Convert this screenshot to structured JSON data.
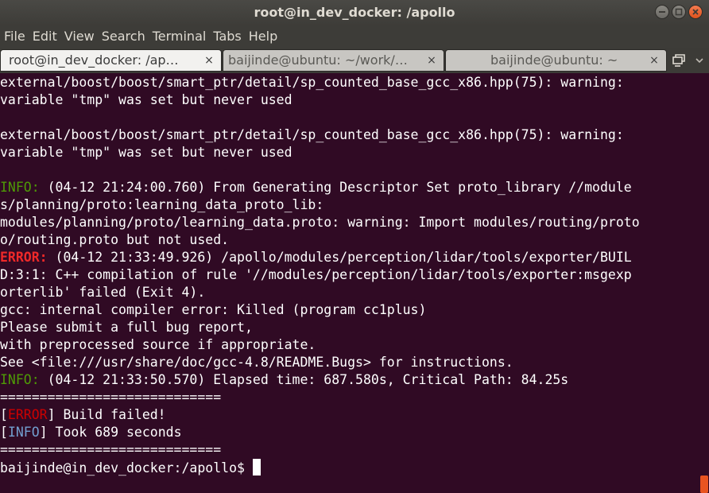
{
  "window": {
    "title": "root@in_dev_docker: /apollo"
  },
  "menu": [
    "File",
    "Edit",
    "View",
    "Search",
    "Terminal",
    "Tabs",
    "Help"
  ],
  "tabs": [
    {
      "label": "root@in_dev_docker: /ap…",
      "active": true
    },
    {
      "label": "baijinde@ubuntu: ~/work/…",
      "active": false
    },
    {
      "label": "baijinde@ubuntu: ~",
      "active": false
    }
  ],
  "tab_close_glyph": "×",
  "terminal": {
    "l1": "external/boost/boost/smart_ptr/detail/sp_counted_base_gcc_x86.hpp(75): warning:",
    "l2": "variable \"tmp\" was set but never used",
    "l3": "external/boost/boost/smart_ptr/detail/sp_counted_base_gcc_x86.hpp(75): warning:",
    "l4": "variable \"tmp\" was set but never used",
    "l5_tag": "INFO:",
    "l5_text": " (04-12 21:24:00.760) From Generating Descriptor Set proto_library //module",
    "l6": "s/planning/proto:learning_data_proto_lib:",
    "l7": "modules/planning/proto/learning_data.proto: warning: Import modules/routing/proto",
    "l8": "o/routing.proto but not used.",
    "l9_tag": "ERROR:",
    "l9_text": " (04-12 21:33:49.926) /apollo/modules/perception/lidar/tools/exporter/BUIL",
    "l10": "D:3:1: C++ compilation of rule '//modules/perception/lidar/tools/exporter:msgexp",
    "l11": "orterlib' failed (Exit 4).",
    "l12": "gcc: internal compiler error: Killed (program cc1plus)",
    "l13": "Please submit a full bug report,",
    "l14": "with preprocessed source if appropriate.",
    "l15": "See <file:///usr/share/doc/gcc-4.8/README.Bugs> for instructions.",
    "l16_tag": "INFO:",
    "l16_text": " (04-12 21:33:50.570) Elapsed time: 687.580s, Critical Path: 84.25s",
    "sep1": "============================",
    "l18_open": "[",
    "l18_tag": "ERROR",
    "l18_close": "] Build failed!",
    "l19_open": "[",
    "l19_tag": "INFO",
    "l19_close": "] Took 689 seconds",
    "sep2": "============================",
    "prompt": "baijinde@in_dev_docker:/apollo$ "
  },
  "colors": {
    "background": "#300a24",
    "info": "#4e9a06",
    "error": "#ef2929",
    "info_bracket": "#729fcf",
    "accent": "#e95420"
  },
  "icons": {
    "minimize": "minimize-icon",
    "maximize": "maximize-icon",
    "close": "close-icon",
    "new_tab": "new-tab-icon",
    "tabs_menu": "chevron-down-icon"
  }
}
